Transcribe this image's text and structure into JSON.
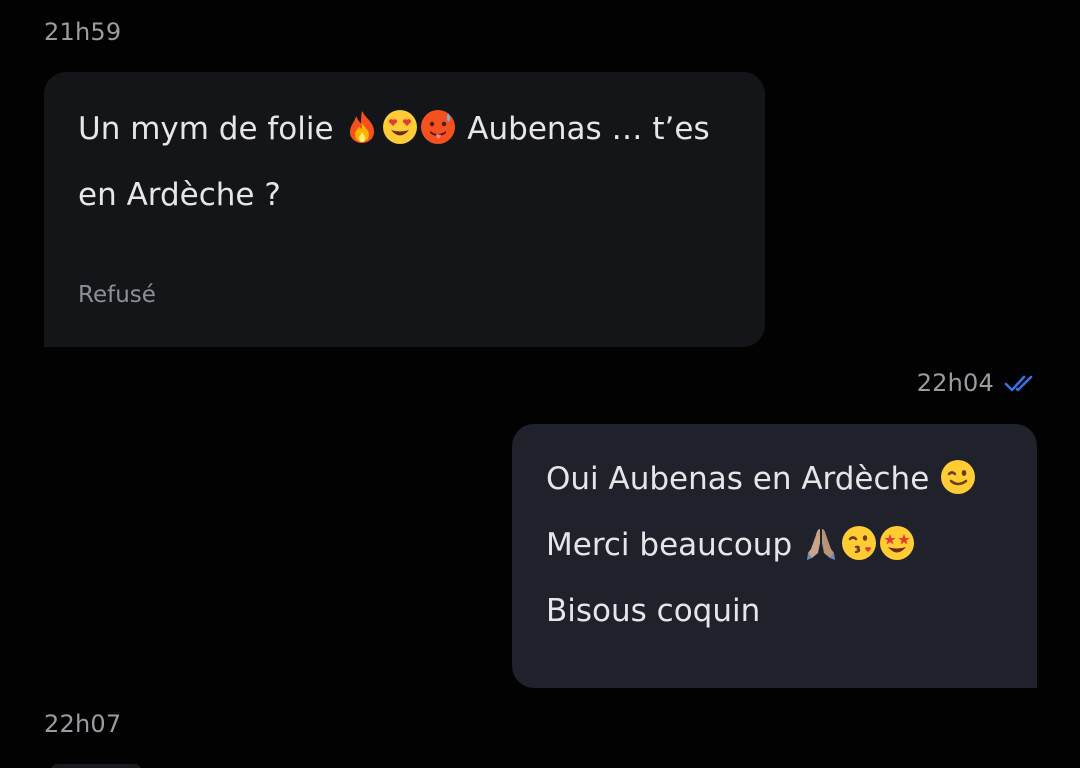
{
  "messages": [
    {
      "time": "21h59",
      "direction": "incoming",
      "lines": [
        {
          "before": "Un mym de folie ",
          "emojis": [
            "fire-emoji",
            "heart-eyes-emoji",
            "hot-face-emoji"
          ],
          "after": " Aubenas … t’es"
        },
        {
          "text": "en Ardèche ?"
        }
      ],
      "status": "Refusé"
    },
    {
      "time": "22h04",
      "direction": "outgoing",
      "read_icon": "double-check-icon",
      "lines": [
        {
          "text": "Oui Aubenas en Ardèche ",
          "emojis": [
            "winking-face-emoji"
          ]
        },
        {
          "text": "Merci beaucoup ",
          "emojis": [
            "folded-hands-emoji",
            "kissing-heart-emoji",
            "star-struck-emoji"
          ]
        },
        {
          "text": "Bisous coquin"
        }
      ]
    },
    {
      "time": "22h07"
    }
  ],
  "colors": {
    "background": "#020203",
    "incoming_bubble": "#141519",
    "outgoing_bubble": "#1f222b",
    "text": "#e6e6e8",
    "muted": "#9a9ca2",
    "read_check": "#3a6fe0"
  }
}
